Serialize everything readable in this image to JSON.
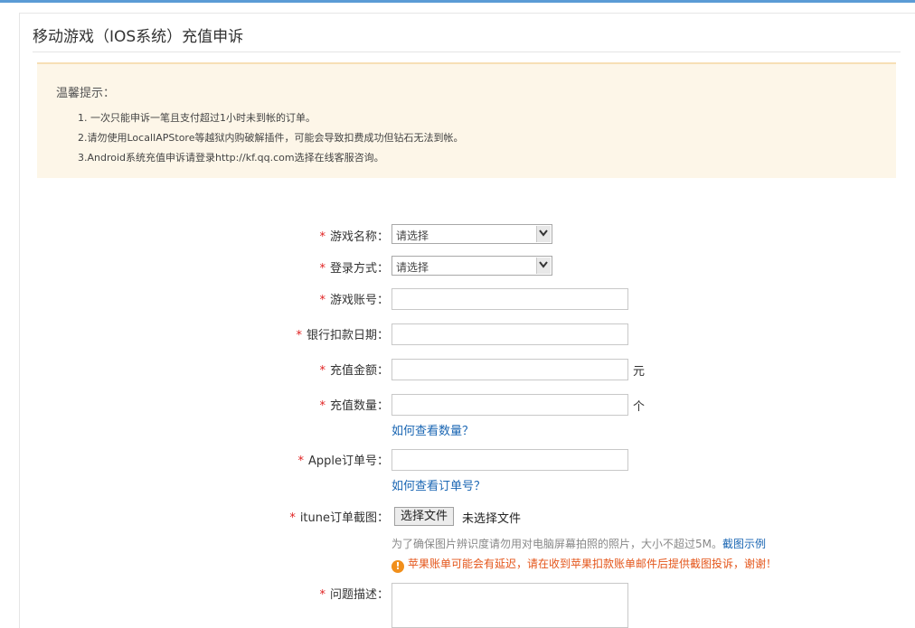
{
  "page": {
    "title": "移动游戏（IOS系统）充值申诉"
  },
  "notice": {
    "title": "温馨提示：",
    "items": [
      "1. 一次只能申诉一笔且支付超过1小时未到帐的订单。",
      "2.请勿使用LocalIAPStore等越狱内购破解插件，可能会导致扣费成功但钻石无法到帐。",
      "3.Android系统充值申诉请登录http://kf.qq.com选择在线客服咨询。"
    ]
  },
  "form": {
    "required_mark": "*",
    "game_name": {
      "label": "游戏名称：",
      "value": "请选择"
    },
    "login_method": {
      "label": "登录方式：",
      "value": "请选择"
    },
    "game_account": {
      "label": "游戏账号："
    },
    "bank_date": {
      "label": "银行扣款日期："
    },
    "amount": {
      "label": "充值金额：",
      "unit": "元"
    },
    "quantity": {
      "label": "充值数量：",
      "unit": "个",
      "help_link": "如何查看数量？"
    },
    "apple_order": {
      "label": "Apple订单号：",
      "help_link": "如何查看订单号？"
    },
    "itunes_screenshot": {
      "label": "itune订单截图：",
      "button": "选择文件",
      "status": "未选择文件",
      "hint": "为了确保图片辨识度请勿用对电脑屏幕拍照的照片，大小不超过5M。",
      "sample_link": "截图示例",
      "warning": "苹果账单可能会有延迟，请在收到苹果扣款账单邮件后提供截图投诉，谢谢！"
    },
    "problem": {
      "label": "问题描述："
    }
  },
  "colors": {
    "accent": "#5b9bd5",
    "required": "#e02020",
    "link": "#1a66b3",
    "warning": "#e4551a",
    "notice_bg": "#fdf6e8"
  },
  "icons": {
    "warning": "warning-icon",
    "select_arrow": "chevron-down-icon"
  }
}
